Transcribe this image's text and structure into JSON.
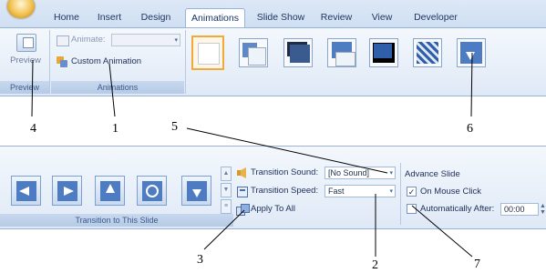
{
  "tabs": [
    "Home",
    "Insert",
    "Design",
    "Animations",
    "Slide Show",
    "Review",
    "View",
    "Developer"
  ],
  "active_tab": "Animations",
  "preview_group": {
    "button_label": "Preview",
    "group_label": "Preview"
  },
  "animations_group": {
    "animate_label": "Animate:",
    "custom_animation_label": "Custom Animation",
    "group_label": "Animations"
  },
  "transition_group": {
    "sound_label": "Transition Sound:",
    "sound_value": "[No Sound]",
    "speed_label": "Transition Speed:",
    "speed_value": "Fast",
    "apply_all_label": "Apply To All",
    "group_label": "Transition to This Slide"
  },
  "advance_group": {
    "title": "Advance Slide",
    "on_mouse_click_label": "On Mouse Click",
    "on_mouse_click_checked": true,
    "auto_after_label": "Automatically After:",
    "auto_after_checked": false,
    "auto_after_value": "00:00"
  },
  "callouts": [
    "1",
    "2",
    "3",
    "4",
    "5",
    "6",
    "7"
  ],
  "colors": {
    "ribbon": "#dfe9f6",
    "accent": "#f2a93b",
    "text": "#1c2f56"
  }
}
